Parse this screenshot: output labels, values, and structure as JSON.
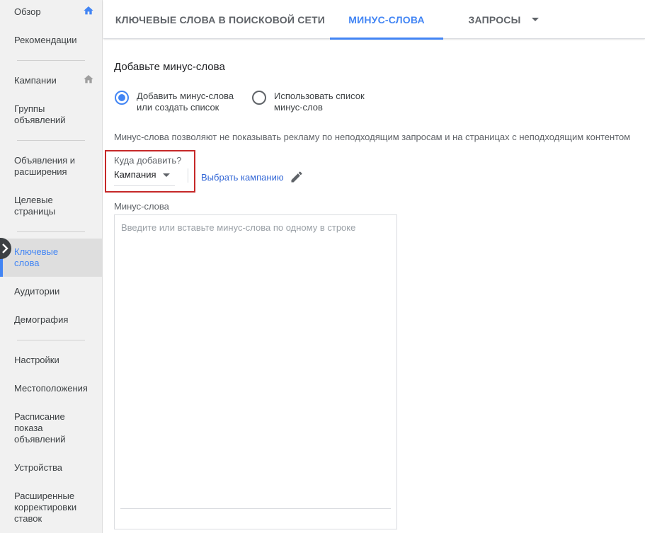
{
  "sidebar": {
    "items": [
      {
        "label": "Обзор"
      },
      {
        "label": "Рекомендации"
      },
      {
        "label": "Кампании"
      },
      {
        "label": "Группы объявлений"
      },
      {
        "label": "Объявления и расширения"
      },
      {
        "label": "Целевые страницы"
      },
      {
        "label": "Ключевые слова"
      },
      {
        "label": "Аудитории"
      },
      {
        "label": "Демография"
      },
      {
        "label": "Настройки"
      },
      {
        "label": "Местоположения"
      },
      {
        "label": "Расписание показа объявлений"
      },
      {
        "label": "Устройства"
      },
      {
        "label": "Расширенные корректировки ставок"
      }
    ],
    "active_index": 6
  },
  "tabs": [
    {
      "label": "КЛЮЧЕВЫЕ СЛОВА В ПОИСКОВОЙ СЕТИ"
    },
    {
      "label": "МИНУС-СЛОВА"
    },
    {
      "label": "ЗАПРОСЫ"
    }
  ],
  "main": {
    "title": "Добавьте минус-слова",
    "radio_options": [
      {
        "label": "Добавить минус-слова или создать список",
        "checked": true
      },
      {
        "label": "Использовать список минус-слов",
        "checked": false
      }
    ],
    "hint": "Минус-слова позволяют не показывать рекламу по неподходящим запросам и на страницах с неподходящим контентом",
    "where_label": "Куда добавить?",
    "where_value": "Кампания",
    "choose_campaign": "Выбрать кампанию",
    "negative_label": "Минус-слова",
    "negative_placeholder": "Введите или вставьте минус-слова по одному в строке",
    "negative_value": ""
  },
  "colors": {
    "accent": "#4285f4",
    "highlight_border": "#c62828",
    "link": "#3367d6"
  }
}
